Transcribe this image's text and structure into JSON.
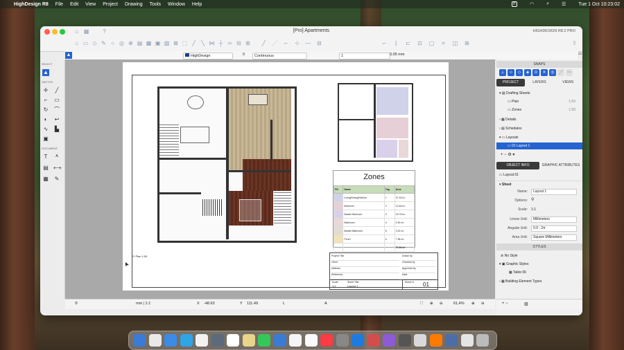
{
  "menubar": {
    "app": "HighDesign R8",
    "items": [
      "File",
      "Edit",
      "View",
      "Project",
      "Drawing",
      "Tools",
      "Window",
      "Help"
    ],
    "clock": "Tue 1 Oct  10:23:02",
    "input_badge": "IT"
  },
  "window": {
    "title": "[Pro] Apartments",
    "edition": "HIGHDESIGN R8.2 PRO"
  },
  "options": {
    "layer": "HighDesign",
    "line_style": "Continuous",
    "line_width": "0.05 mm",
    "count": "1",
    "zero": "0"
  },
  "tools": {
    "select": "SELECT",
    "sketch": "SKETCH",
    "document": "DOCUMENT"
  },
  "zones": {
    "title": "Zones",
    "headers": [
      "Fill",
      "Name",
      "Tag",
      "Area"
    ],
    "rows": [
      {
        "name": "Living/Dining/Kitchen",
        "tag": "1",
        "area": "37.33 m²",
        "color": "#cfd2e8"
      },
      {
        "name": "Bedroom",
        "tag": "2",
        "area": "12.46 m²",
        "color": "#e6cfd6"
      },
      {
        "name": "Master Bedroom",
        "tag": "3",
        "area": "15.75 m²",
        "color": "#d9d0ea"
      },
      {
        "name": "Bathroom",
        "tag": "4",
        "area": "4.92 m²",
        "color": "#e8d8d8"
      },
      {
        "name": "Master Bathroom",
        "tag": "5",
        "area": "3.02 m²",
        "color": "#e3dcd3"
      },
      {
        "name": "Porch",
        "tag": "6",
        "area": "7.98 m²",
        "color": "#f1e2b8"
      }
    ],
    "total": "71.16 m²"
  },
  "titleblock": {
    "scale_label": "Scale",
    "scale": "1:1",
    "sheet_title_label": "Sheet Title",
    "sheet_title": "Layout 1",
    "sheet_no_label": "Sheet N.",
    "sheet_no": "01",
    "left_labels": [
      "Project Title",
      "Client",
      "Address",
      "Reference"
    ],
    "right_labels": [
      "Drawn by",
      "Checked by",
      "Approved by",
      "Date"
    ]
  },
  "plan_label": {
    "name": "Plan",
    "scale": "1:50"
  },
  "panel": {
    "snaps": "SNAPS",
    "tabs": [
      "PROJECT",
      "LAYERS",
      "VIEWS"
    ],
    "tree": {
      "drafting_sheets": "Drafting Sheets",
      "plan": "Plan",
      "plan_scale": "1:50",
      "zones": "Zones",
      "zones_scale": "1:50",
      "details": "Details",
      "schedules": "Schedules",
      "layouts": "Layouts",
      "layout01": "01 Layout 1"
    },
    "info_tabs": [
      "OBJECT INFO",
      "GRAPHIC ATTRIBUTES"
    ],
    "object": "Layout 01",
    "sheet_header": "Sheet",
    "props": {
      "name_label": "Name:",
      "name": "Layout 1",
      "options_label": "Options:",
      "scale_label": "Scale:",
      "scale": "1:1",
      "linear_label": "Linear Unit:",
      "linear": "Millimeters",
      "angular_label": "Angular Unit:",
      "angular": "0.0 - 2π",
      "area_label": "Area Unit:",
      "area": "Square Millimeters"
    },
    "styles_header": "STYLES",
    "styles": {
      "no_style": "No Style",
      "graphic_styles": "Graphic Styles",
      "table": "Table 06",
      "building": "Building Element Types"
    }
  },
  "status": {
    "units": "mm | 1:1",
    "x_label": "X",
    "x": "-48.63",
    "y_label": "Y",
    "y": "111.49",
    "l_label": "L",
    "a_label": "A",
    "zoom": "61,4%"
  }
}
